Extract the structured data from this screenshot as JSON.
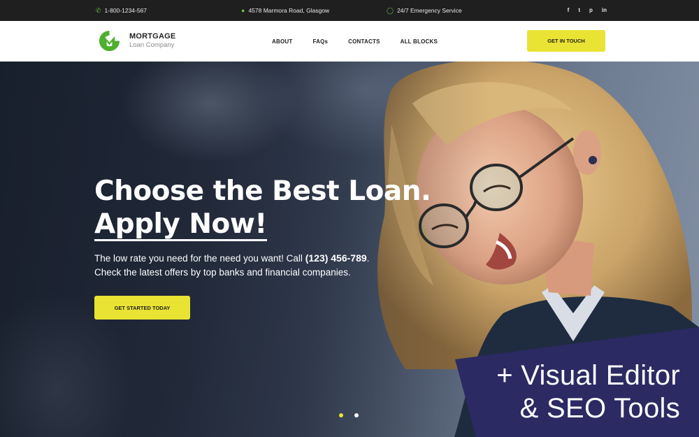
{
  "topbar": {
    "phone": "1-800-1234-567",
    "address": "4578 Marmora Road, Glasgow",
    "hours": "24/7 Emergency Service",
    "social": [
      "f",
      "t",
      "p",
      "in"
    ],
    "icons": {
      "phone": "phone-icon",
      "address": "location-pin-icon",
      "hours": "clock-icon"
    }
  },
  "header": {
    "logo_name": "MORTGAGE",
    "logo_sub": "Loan Company",
    "nav": [
      "ABOUT",
      "FAQs",
      "CONTACTS",
      "ALL BLOCKS"
    ],
    "cta": "GET IN TOUCH"
  },
  "hero": {
    "title_line1": "Choose the Best Loan.",
    "title_line2": "Apply Now!",
    "text_prefix": "The low rate you need for the need you want! Call",
    "text_phone": "(123) 456-789",
    "text_after_phone": ".",
    "text_line2": "Check the latest offers by top banks and financial companies.",
    "button": "GET STARTED TODAY",
    "slides": 2,
    "active_slide": 1
  },
  "promo": {
    "line1": "+ Visual Editor",
    "line2": "& SEO Tools"
  },
  "colors": {
    "accent": "#e9e334",
    "brand_green": "#4caf2e",
    "topbar": "#1f1f1f",
    "promo_bg": "#2b2a63"
  }
}
